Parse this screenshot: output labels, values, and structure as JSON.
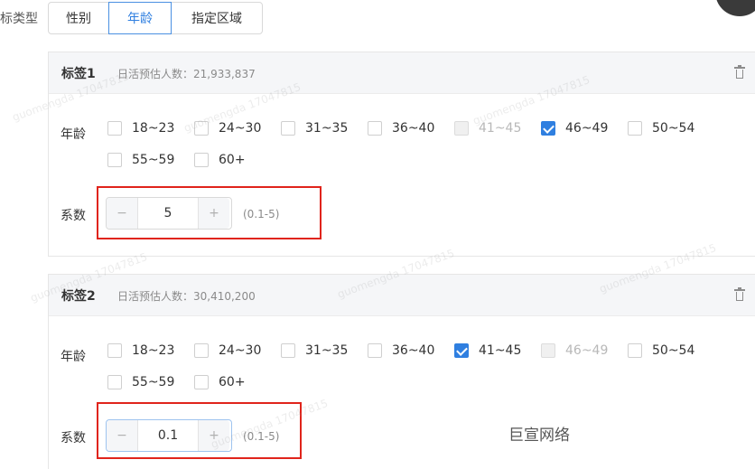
{
  "filter": {
    "type_label": "标类型",
    "tabs": [
      {
        "label": "性别",
        "active": false
      },
      {
        "label": "年龄",
        "active": true
      },
      {
        "label": "指定区域",
        "active": false
      }
    ]
  },
  "cards": [
    {
      "title": "标签1",
      "dau_text": "日活预估人数：21,933,837",
      "age_label": "年龄",
      "options": [
        {
          "label": "18~23",
          "state": "unchecked"
        },
        {
          "label": "24~30",
          "state": "unchecked"
        },
        {
          "label": "31~35",
          "state": "unchecked"
        },
        {
          "label": "36~40",
          "state": "unchecked"
        },
        {
          "label": "41~45",
          "state": "disabled"
        },
        {
          "label": "46~49",
          "state": "checked"
        },
        {
          "label": "50~54",
          "state": "unchecked"
        },
        {
          "label": "55~59",
          "state": "unchecked"
        },
        {
          "label": "60+",
          "state": "unchecked"
        }
      ],
      "coef_label": "系数",
      "coef_value": "5",
      "minus": "−",
      "plus": "+",
      "range_hint": "(0.1-5)"
    },
    {
      "title": "标签2",
      "dau_text": "日活预估人数：30,410,200",
      "age_label": "年龄",
      "options": [
        {
          "label": "18~23",
          "state": "unchecked"
        },
        {
          "label": "24~30",
          "state": "unchecked"
        },
        {
          "label": "31~35",
          "state": "unchecked"
        },
        {
          "label": "36~40",
          "state": "unchecked"
        },
        {
          "label": "41~45",
          "state": "checked"
        },
        {
          "label": "46~49",
          "state": "disabled"
        },
        {
          "label": "50~54",
          "state": "unchecked"
        },
        {
          "label": "55~59",
          "state": "unchecked"
        },
        {
          "label": "60+",
          "state": "unchecked"
        }
      ],
      "coef_label": "系数",
      "coef_value": "0.1",
      "minus": "−",
      "plus": "+",
      "range_hint": "(0.1-5)"
    }
  ],
  "watermark_text": "guomengda 17047815",
  "brand": "巨宣网络",
  "colors": {
    "accent": "#2f7fe0",
    "highlight_box": "#e0241b"
  },
  "icons": {
    "delete": "trash-icon",
    "check": "check-icon"
  }
}
